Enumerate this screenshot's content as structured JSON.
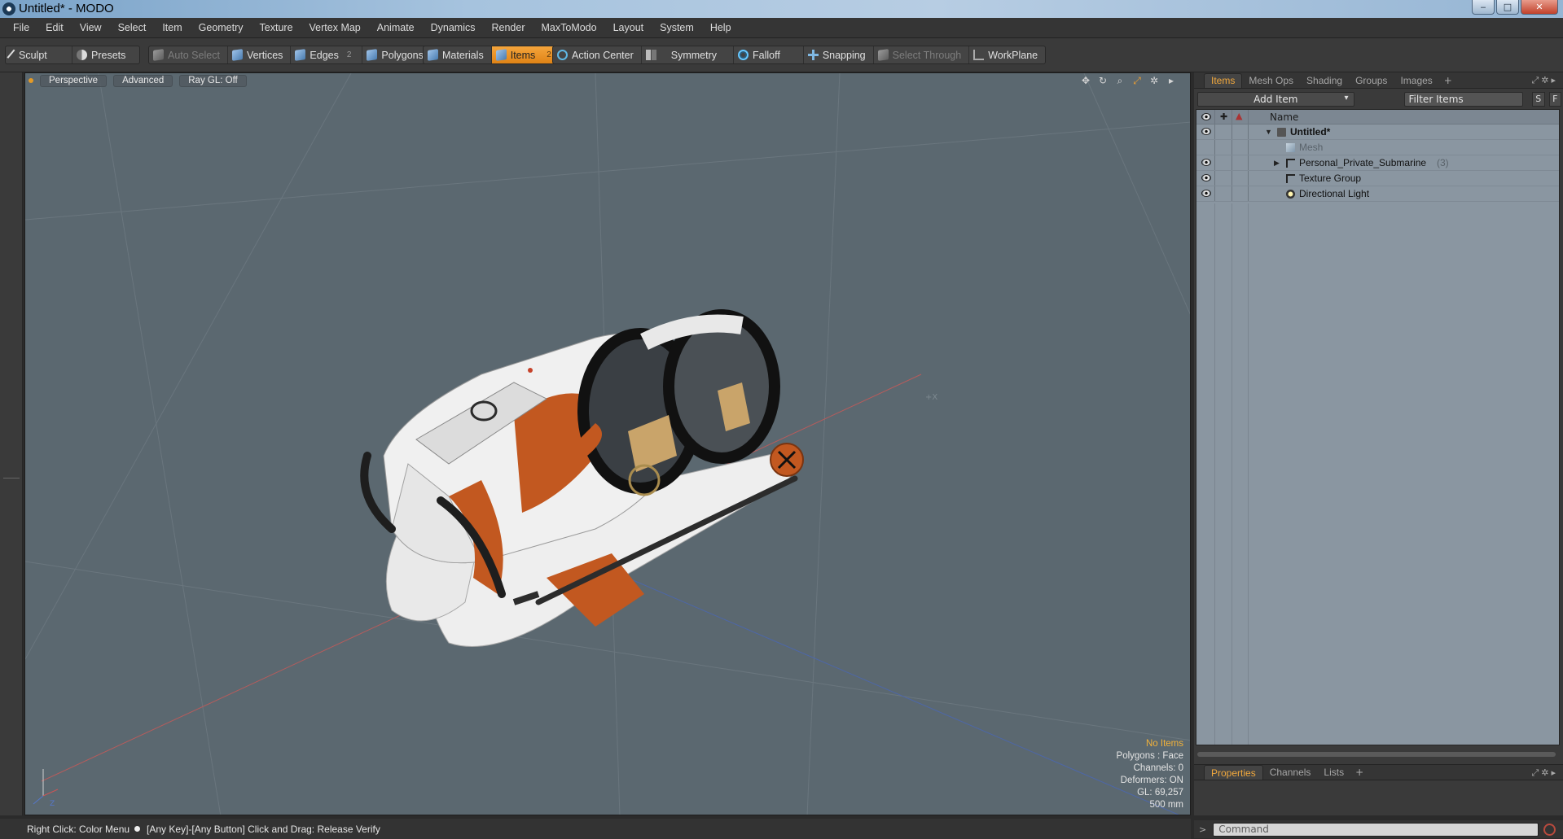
{
  "window": {
    "title": "Untitled* - MODO",
    "minimize": "‒",
    "maximize": "□",
    "close": "✕"
  },
  "menu": [
    "File",
    "Edit",
    "View",
    "Select",
    "Item",
    "Geometry",
    "Texture",
    "Vertex Map",
    "Animate",
    "Dynamics",
    "Render",
    "MaxToModo",
    "Layout",
    "System",
    "Help"
  ],
  "toolbar": {
    "sculpt": "Sculpt",
    "presets": "Presets",
    "auto_select": "Auto Select",
    "vertices": "Vertices",
    "edges": "Edges",
    "edges_count": "2",
    "polygons": "Polygons",
    "materials": "Materials",
    "items": "Items",
    "items_count": "2",
    "action_center": "Action Center",
    "symmetry": "Symmetry",
    "falloff": "Falloff",
    "snapping": "Snapping",
    "select_through": "Select Through",
    "workplane": "WorkPlane",
    "active_color": "#f0a030"
  },
  "viewport": {
    "tabs": [
      "Perspective",
      "Advanced",
      "Ray GL: Off"
    ],
    "tools": [
      "move-view-icon",
      "rotate-view-icon",
      "zoom-view-icon",
      "maximize-view-icon",
      "settings-icon",
      "menu-arrow-icon"
    ],
    "info": {
      "selection": "No Items",
      "polygons": "Polygons : Face",
      "channels": "Channels: 0",
      "deformers": "Deformers: ON",
      "gl": "GL: 69,257",
      "scale": "500 mm"
    },
    "axis_labels": {
      "x": "X",
      "z": "Z"
    }
  },
  "items_panel": {
    "tabs": [
      "Items",
      "Mesh Ops",
      "Shading",
      "Groups",
      "Images"
    ],
    "add_item": "Add Item",
    "filter_placeholder": "Filter Items",
    "s_button": "S",
    "f_button": "F",
    "column_name": "Name",
    "tree": [
      {
        "label": "Untitled*",
        "indent": 0
      },
      {
        "label": "Mesh",
        "indent": 1
      },
      {
        "label": "Personal_Private_Submarine",
        "count": "(3)",
        "indent": 1
      },
      {
        "label": "Texture Group",
        "indent": 1
      },
      {
        "label": "Directional Light",
        "indent": 1
      }
    ]
  },
  "properties_panel": {
    "tabs": [
      "Properties",
      "Channels",
      "Lists"
    ]
  },
  "command": {
    "placeholder": "Command"
  },
  "status": {
    "left": "Right Click: Color Menu",
    "right": "[Any Key]-[Any Button] Click and Drag: Release Verify"
  }
}
